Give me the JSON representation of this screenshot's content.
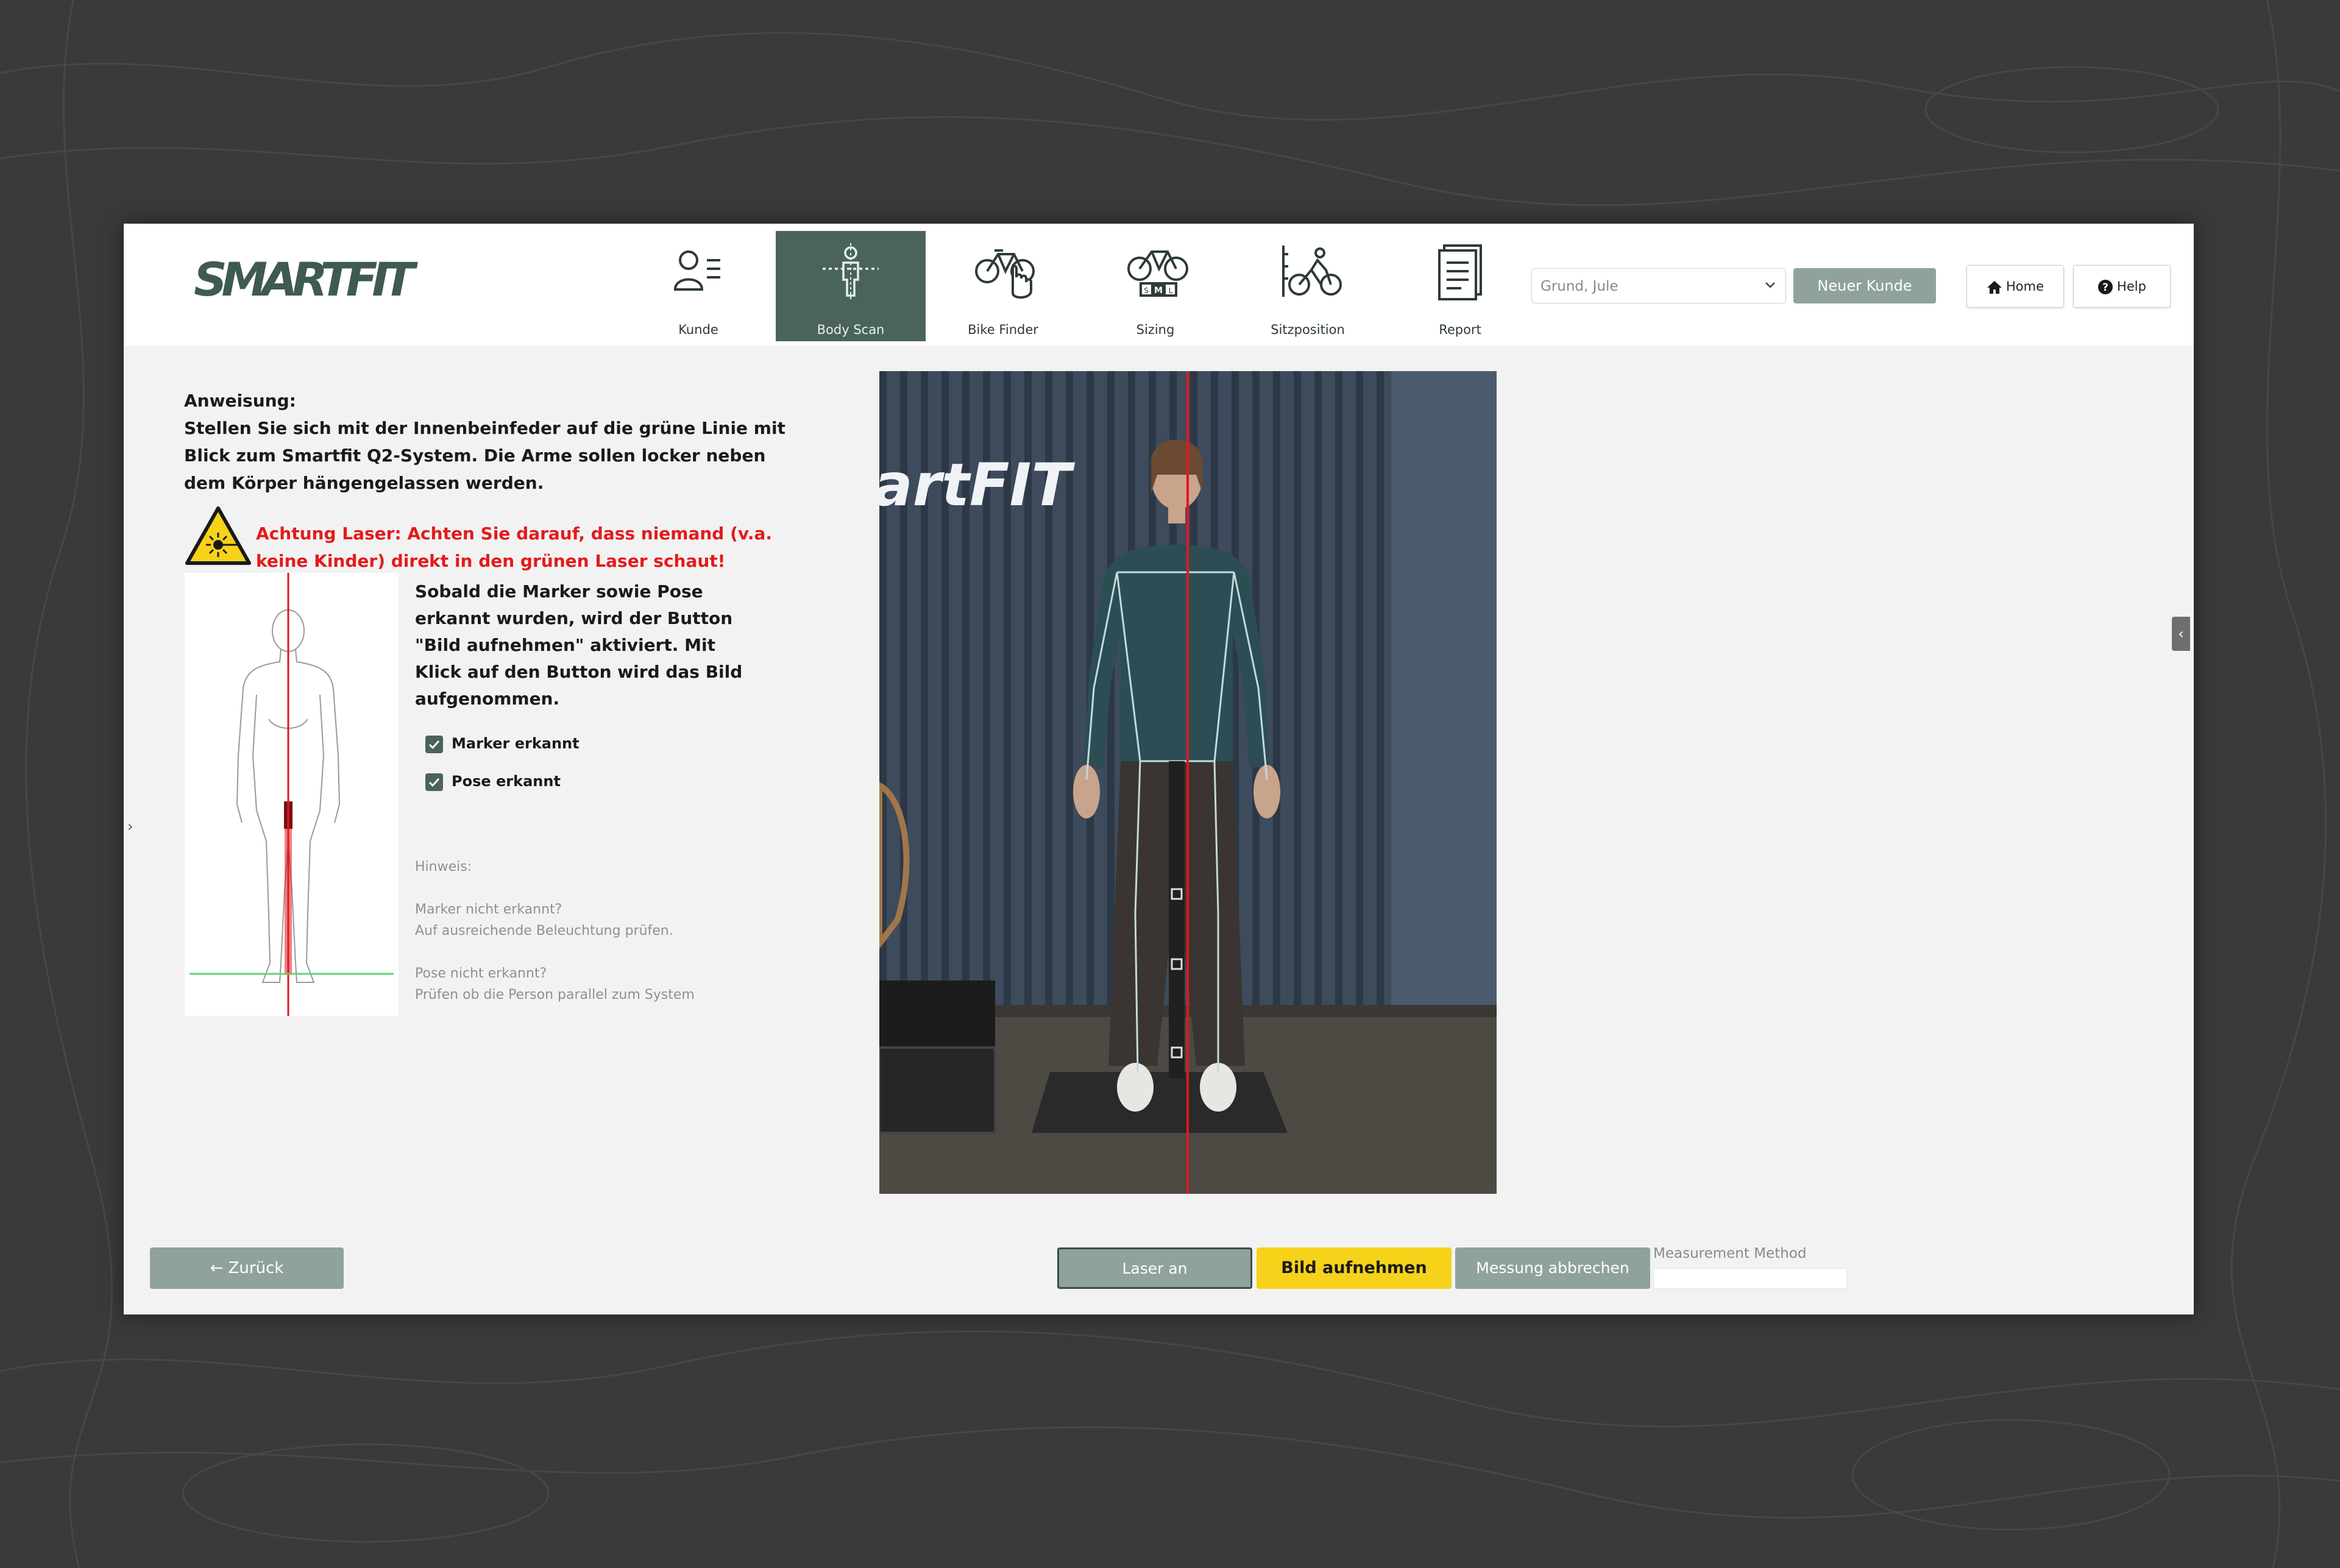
{
  "brand": {
    "logo_text": "SMARTFIT"
  },
  "nav": {
    "items": [
      {
        "label": "Kunde",
        "icon": "user-list-icon",
        "active": false
      },
      {
        "label": "Body Scan",
        "icon": "body-scan-icon",
        "active": true
      },
      {
        "label": "Bike Finder",
        "icon": "bike-finder-icon",
        "active": false
      },
      {
        "label": "Sizing",
        "icon": "bike-sizing-icon",
        "active": false
      },
      {
        "label": "Sitzposition",
        "icon": "seat-position-icon",
        "active": false
      },
      {
        "label": "Report",
        "icon": "report-icon",
        "active": false
      }
    ]
  },
  "customer": {
    "selected": "Grund, Jule",
    "new_button": "Neuer Kunde"
  },
  "top_buttons": {
    "home": "Home",
    "help": "Help"
  },
  "instructions": {
    "heading": "Anweisung:",
    "body": "Stellen Sie sich mit der Innenbeinfeder auf die grüne Linie mit Blick zum Smartfit Q2-System. Die Arme sollen locker neben dem Körper hängengelassen werden."
  },
  "warning": {
    "icon": "laser-warning-icon",
    "text": "Achtung Laser: Achten Sie darauf, dass niemand (v.a. keine Kinder) direkt in den grünen Laser schaut!"
  },
  "info_text": "Sobald die Marker sowie Pose erkannt wurden, wird der Button \"Bild aufnehmen\" aktiviert. Mit Klick auf den Button wird das Bild aufgenommen.",
  "checks": [
    {
      "label": "Marker erkannt",
      "checked": true
    },
    {
      "label": "Pose erkannt",
      "checked": true
    }
  ],
  "hints": {
    "heading": "Hinweis:",
    "marker_title": "Marker nicht erkannt?",
    "marker_text": "Auf ausreichende Beleuchtung prüfen.",
    "pose_title": "Pose nicht erkannt?",
    "pose_text": "Prüfen ob die Person parallel zum System"
  },
  "camera": {
    "wall_text": "artFIT"
  },
  "buttons": {
    "back": "← Zurück",
    "laser": "Laser an",
    "capture": "Bild aufnehmen",
    "cancel": "Messung abbrechen"
  },
  "measurement": {
    "label": "Measurement Method",
    "value": ""
  },
  "side_tab": "‹",
  "left_arrow": "›",
  "colors": {
    "accent_dark": "#4a6459",
    "accent": "#8fa39b",
    "capture": "#f7d21b",
    "warning": "#e31b1b",
    "laser_line": "#e3161e",
    "floor_line": "#5fd47a"
  }
}
